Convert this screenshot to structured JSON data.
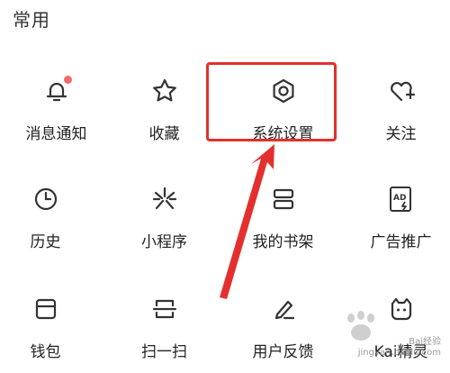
{
  "section": {
    "title": "常用"
  },
  "items": [
    {
      "label": "消息通知",
      "icon": "bell-icon",
      "has_badge": true
    },
    {
      "label": "收藏",
      "icon": "star-icon"
    },
    {
      "label": "系统设置",
      "icon": "gear-icon",
      "highlighted": true
    },
    {
      "label": "关注",
      "icon": "heart-plus-icon"
    },
    {
      "label": "历史",
      "icon": "clock-icon"
    },
    {
      "label": "小程序",
      "icon": "mini-program-icon"
    },
    {
      "label": "我的书架",
      "icon": "bookshelf-icon"
    },
    {
      "label": "广告推广",
      "icon": "ad-icon"
    },
    {
      "label": "钱包",
      "icon": "wallet-icon"
    },
    {
      "label": "扫一扫",
      "icon": "scan-icon"
    },
    {
      "label": "用户反馈",
      "icon": "feedback-pen-icon"
    },
    {
      "label": "Kai精灵",
      "icon": "cat-face-icon"
    }
  ],
  "annotation": {
    "color": "#e3302e"
  },
  "watermark": {
    "line1": "Bai经验",
    "line2": "jingyan.baidu.com"
  }
}
